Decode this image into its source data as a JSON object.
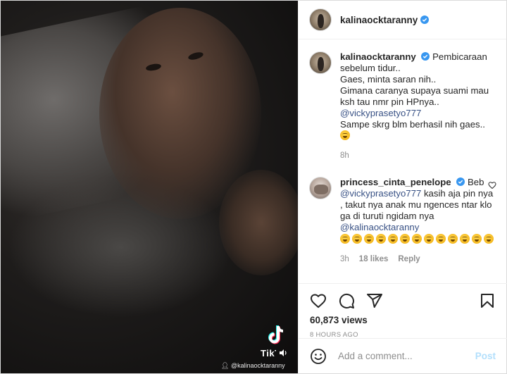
{
  "media": {
    "watermark_brand": "TikTok",
    "watermark_user": "@kalinaocktaranny"
  },
  "header": {
    "username": "kalinaocktaranny"
  },
  "caption": {
    "username": "kalinaocktaranny",
    "lines": [
      "Pembicaraan sebelum tidur..",
      "Gaes, minta saran nih..",
      "Gimana caranya supaya suami mau ksh tau nmr pin HPnya..",
      "@vickyprasetyo777",
      "Sampe skrg blm berhasil nih gaes.."
    ],
    "time": "8h"
  },
  "comment": {
    "username": "princess_cinta_penelope",
    "text_start": "Beb",
    "mention1": "@vickyprasetyo777",
    "text_mid": "kasih aja pin nya , takut nya anak mu ngences ntar klo ga di turuti ngidam nya",
    "mention2": "@kalinaocktaranny",
    "time": "3h",
    "likes": "18 likes",
    "reply": "Reply"
  },
  "stats": {
    "views": "60,873 views",
    "date": "8 HOURS AGO"
  },
  "add_comment": {
    "placeholder": "Add a comment...",
    "post_label": "Post"
  },
  "colors": {
    "link": "#385185",
    "verified": "#3897f0",
    "post_disabled": "#b2dffc"
  },
  "icons": [
    "verified-badge-icon",
    "heart-icon",
    "comment-icon",
    "share-icon",
    "save-icon",
    "emoji-icon",
    "tiktok-logo-icon",
    "sound-icon"
  ]
}
